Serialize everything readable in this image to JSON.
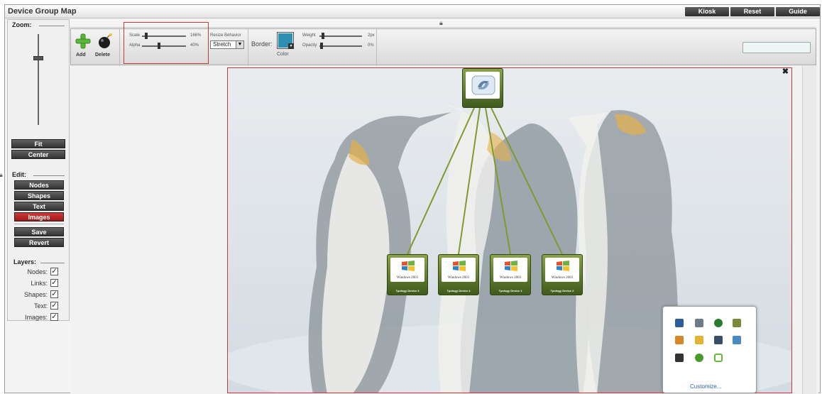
{
  "window": {
    "title": "Device Group Map"
  },
  "top_buttons": [
    "Kiosk",
    "Reset",
    "Guide"
  ],
  "zoom": {
    "label": "Zoom:",
    "fit_label": "Fit",
    "center_label": "Center",
    "level": 0.75
  },
  "edit": {
    "label": "Edit:",
    "items": [
      "Nodes",
      "Shapes",
      "Text",
      "Images"
    ],
    "active": "Images",
    "save_label": "Save",
    "revert_label": "Revert"
  },
  "layers": {
    "label": "Layers:",
    "items": [
      {
        "label": "Nodes:",
        "checked": true
      },
      {
        "label": "Links:",
        "checked": true
      },
      {
        "label": "Shapes:",
        "checked": true
      },
      {
        "label": "Text:",
        "checked": true
      },
      {
        "label": "Images:",
        "checked": true
      }
    ]
  },
  "toolbar": {
    "add_label": "Add",
    "delete_label": "Delete",
    "scale_label": "Scale",
    "scale_value": "166%",
    "alpha_label": "Alpha",
    "alpha_value": "40%",
    "resize_behavior_label": "Resize Behavior",
    "resize_behavior_value": "Stretch",
    "border_label": "Border:",
    "color_label": "Color",
    "weight_label": "Weight",
    "weight_value": "2px",
    "opacity_label": "Opacity",
    "opacity_value": "0%",
    "border_color": "#2f8fb2"
  },
  "map": {
    "group_node_label": "",
    "child_nodes": [
      {
        "os_label": "Windows 2003",
        "name": "Tpology Device 3"
      },
      {
        "os_label": "Windows 2003",
        "name": "Tpology Device 4"
      },
      {
        "os_label": "Windows 2003",
        "name": "Tpology Device 1"
      },
      {
        "os_label": "Windows 2003",
        "name": "Tpology Device 2"
      }
    ],
    "link_color": "#7f9a2e",
    "selection_color": "#c43a3a"
  },
  "palette": {
    "customize_label": "Customize..."
  }
}
